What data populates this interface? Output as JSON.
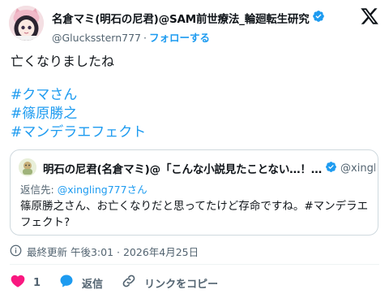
{
  "author": {
    "name": "名倉マミ(明石の尼君)@SAM前世療法_輪廻転生研究",
    "handle": "@Glucksstern777",
    "separator": "·",
    "follow_label": "フォローする"
  },
  "post": {
    "text": "亡くなりましたね",
    "hashtags": [
      "#クマさん",
      "#篠原勝之",
      "#マンデラエフェクト"
    ]
  },
  "quote": {
    "name": "明石の尼君(名倉マミ)@「こんな小説見たことない…！…",
    "handle": "@xingl…",
    "reply_prefix": "返信先:",
    "reply_to": "@xingling777さん",
    "text": "篠原勝之さん、お亡くなりだと思ってたけど存命ですね。#マンデラエフェクト?"
  },
  "meta": {
    "updated": "最終更新 午後3:01 · 2026年4月25日"
  },
  "actions": {
    "like_count": "1",
    "reply_label": "返信",
    "copy_link_label": "リンクをコピー"
  },
  "colors": {
    "accent": "#1d9bf0",
    "like": "#f91880",
    "muted": "#536471",
    "text": "#0f1419"
  },
  "icons": [
    "verified-badge-icon",
    "x-logo-icon",
    "info-icon",
    "heart-icon",
    "reply-icon",
    "link-icon"
  ]
}
